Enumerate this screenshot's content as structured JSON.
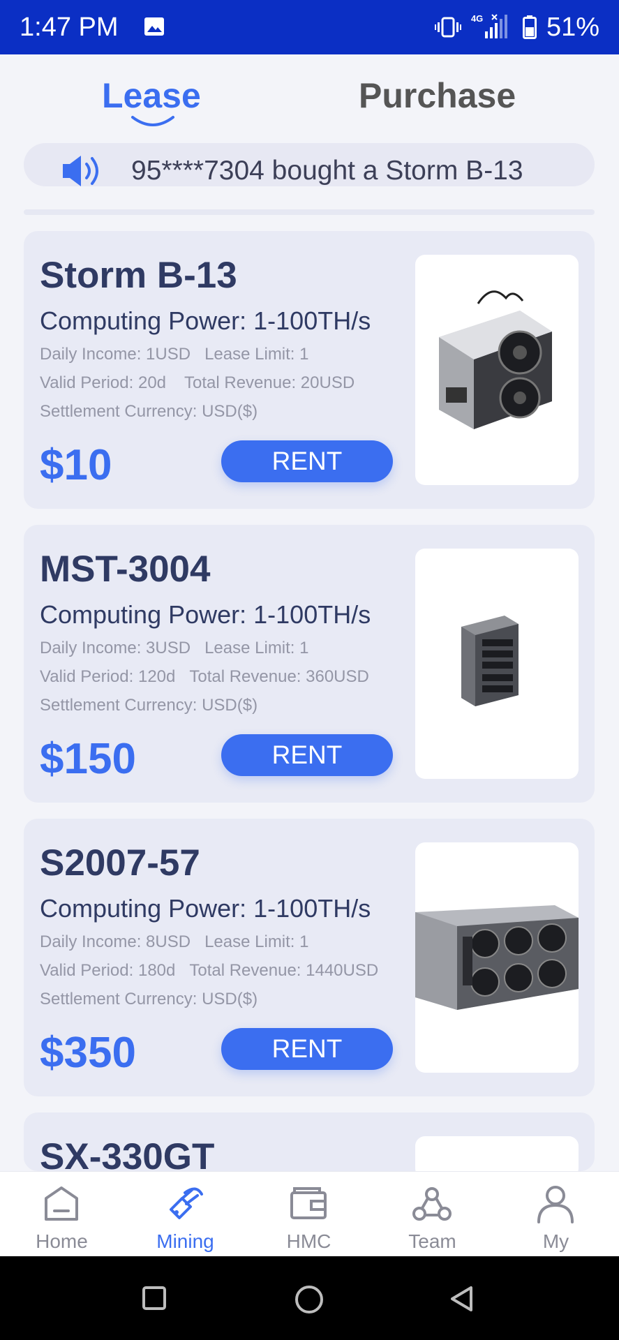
{
  "status_bar": {
    "time": "1:47 PM",
    "network": "4G",
    "battery": "51%"
  },
  "tabs": {
    "lease": "Lease",
    "purchase": "Purchase",
    "active": "lease"
  },
  "notice": {
    "text": "95****7304 bought a Storm B-13"
  },
  "labels": {
    "computing_power": "Computing Power:",
    "daily_income": "Daily Income:",
    "lease_limit": "Lease Limit:",
    "valid_period": "Valid Period:",
    "total_revenue": "Total Revenue:",
    "settlement_currency": "Settlement Currency:"
  },
  "products": [
    {
      "name": "Storm B-13",
      "computing_power": "Computing Power: 1-100TH/s",
      "daily_income": "Daily Income: 1USD",
      "lease_limit": "Lease Limit: 1",
      "valid_period": "Valid Period: 20d",
      "total_revenue": "Total Revenue: 20USD",
      "settlement_currency": "Settlement Currency: USD($)",
      "price": "$10",
      "button": "RENT"
    },
    {
      "name": "MST-3004",
      "computing_power": "Computing Power: 1-100TH/s",
      "daily_income": "Daily Income: 3USD",
      "lease_limit": "Lease Limit: 1",
      "valid_period": "Valid Period: 120d",
      "total_revenue": "Total Revenue: 360USD",
      "settlement_currency": "Settlement Currency: USD($)",
      "price": "$150",
      "button": "RENT"
    },
    {
      "name": "S2007-57",
      "computing_power": "Computing Power: 1-100TH/s",
      "daily_income": "Daily Income: 8USD",
      "lease_limit": "Lease Limit: 1",
      "valid_period": "Valid Period: 180d",
      "total_revenue": "Total Revenue: 1440USD",
      "settlement_currency": "Settlement Currency: USD($)",
      "price": "$350",
      "button": "RENT"
    },
    {
      "name": "SX-330GT"
    }
  ],
  "bottom_nav": [
    {
      "label": "Home",
      "icon": "home-icon"
    },
    {
      "label": "Mining",
      "icon": "mining-icon",
      "active": true
    },
    {
      "label": "HMC",
      "icon": "wallet-icon"
    },
    {
      "label": "Team",
      "icon": "team-icon"
    },
    {
      "label": "My",
      "icon": "person-icon"
    }
  ],
  "colors": {
    "status_bar": "#0b2fc4",
    "accent": "#3b6ef0",
    "title": "#2f3a63",
    "muted": "#9496a6",
    "card_bg": "#e8eaf5"
  }
}
